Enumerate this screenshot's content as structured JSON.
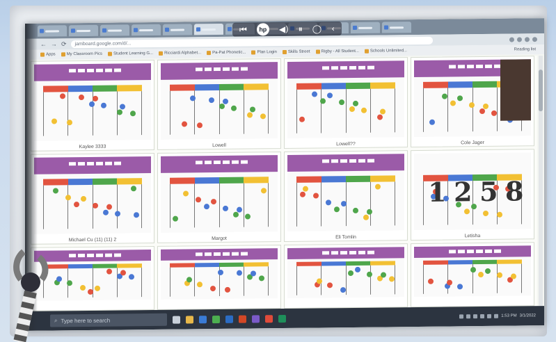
{
  "browser": {
    "tab_count": 12,
    "media_controls": [
      "⏮",
      "◀)",
      "⏸",
      "◯",
      "‹"
    ],
    "hp_label": "hp",
    "nav_icons": [
      "←",
      "→",
      "⟳"
    ],
    "url": "jamboard.google.com/d/...",
    "bookmarks": [
      "Apps",
      "My Classroom Pics",
      "Student Learning G...",
      "Ricciardi Alphabet...",
      "Pa-Pat Phonetic...",
      "Plan Login",
      "Skills Street",
      "Rigby - All Student...",
      "Schools Unlimited..."
    ],
    "other_bookmarks": "Reading list"
  },
  "tiles": [
    {
      "name": "Kaylee 3333",
      "id": "tile-1"
    },
    {
      "name": "Lowell",
      "id": "tile-2"
    },
    {
      "name": "Lowell??",
      "id": "tile-3"
    },
    {
      "name": "Cole Jager",
      "id": "tile-4"
    },
    {
      "name": "Michael Cu (11) (11) 2",
      "id": "tile-5"
    },
    {
      "name": "Margot",
      "id": "tile-6"
    },
    {
      "name": "Eli Tomlin",
      "id": "tile-7"
    },
    {
      "name": "Letisha",
      "id": "tile-8"
    },
    {
      "name": "",
      "id": "tile-9"
    },
    {
      "name": "",
      "id": "tile-10"
    },
    {
      "name": "",
      "id": "tile-11"
    },
    {
      "name": "",
      "id": "tile-12"
    }
  ],
  "handwritten_digits": [
    "1",
    "2",
    "5",
    "8"
  ],
  "taskbar": {
    "search_placeholder": "Type here to search",
    "tray_time": "1:53 PM",
    "tray_date": "3/1/2022"
  },
  "colors": {
    "purple_header": "#9b5ba8",
    "red": "#e25440",
    "blue": "#4a78d4",
    "green": "#4fa64b",
    "yellow": "#f2c033"
  }
}
